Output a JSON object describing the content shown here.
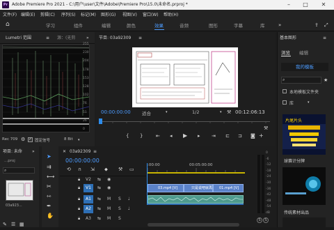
{
  "titlebar": {
    "app_badge": "Pr",
    "title": "Adobe Premiere Pro 2021 - C:\\用户\\user\\文件\\Adobe\\Premiere Pro\\15.0\\未命名.prproj *",
    "minimize": "–",
    "maximize": "□",
    "close": "✕"
  },
  "menu": [
    "文件(F)",
    "编辑(E)",
    "剪辑(C)",
    "序列(S)",
    "标记(M)",
    "图形(G)",
    "视图(V)",
    "窗口(W)",
    "帮助(H)"
  ],
  "workspaces": [
    "学习",
    "组件",
    "编辑",
    "颜色",
    "效果",
    "音频",
    "图形",
    "字幕",
    "库"
  ],
  "workspace_active": "效果",
  "lumetri": {
    "tab_label": "Lumetri 范围",
    "tab2_label": "源：(无剪",
    "left_scale": [
      "100",
      "90",
      "80",
      "70",
      "60",
      "50",
      "40",
      "30",
      "20",
      "10",
      "0"
    ],
    "right_scale": [
      "255",
      "230",
      "204",
      "178",
      "153",
      "128",
      "102",
      "76",
      "51",
      "26",
      "0"
    ],
    "rec_label": "Rec 709",
    "clamp_label": "固定信号",
    "bitdepth": "8 Bit"
  },
  "program": {
    "tab_label": "节目: 03a92309",
    "timecode_in": "00:00:00:00",
    "fit_label": "适合",
    "quality": "1/2",
    "timecode_out": "00:12:06:13"
  },
  "basic_graphics": {
    "title": "基本图形",
    "tab_browse": "浏览",
    "tab_edit": "编辑",
    "my_templates": "我的模板",
    "local_templates": "本地模板文件夹",
    "library_label": "库",
    "thumb1_label": "片尾片头",
    "thumb2_label": "球赛计分牌",
    "thumb3_label": "传统素材出品"
  },
  "project": {
    "tab_label": "项目: 未命",
    "file_label": "...proj",
    "clip_label": "03a923..."
  },
  "timeline": {
    "tab_label": "03a92309",
    "timecode": "00:00:00:00",
    "ruler_start": ":00:00",
    "ruler_mid": "00:05:00:00",
    "tracks": [
      {
        "name": "V2",
        "kind": "video"
      },
      {
        "name": "V1",
        "kind": "video"
      },
      {
        "name": "A1",
        "kind": "audio"
      },
      {
        "name": "A2",
        "kind": "audio"
      },
      {
        "name": "A3",
        "kind": "audio"
      }
    ],
    "clip_v1a": "03.mp4 [V]",
    "clip_v1b": "只是说吧就再",
    "clip_v1c": "01.mp4 [V]",
    "mute_label": "M",
    "solo_label": "S"
  },
  "meters": {
    "scale": [
      "0",
      "-6",
      "-12",
      "-18",
      "-24",
      "-30",
      "-36",
      "-42",
      "-48",
      "-54",
      "dB"
    ],
    "solo_labels": [
      "S",
      "S"
    ]
  },
  "colors": {
    "accent": "#4d9cff",
    "playhead": "#2d8ceb",
    "clip_video": "#5b82c9",
    "clip_audio": "#4f9b8e",
    "highlight_track": "#2e6fb5"
  }
}
